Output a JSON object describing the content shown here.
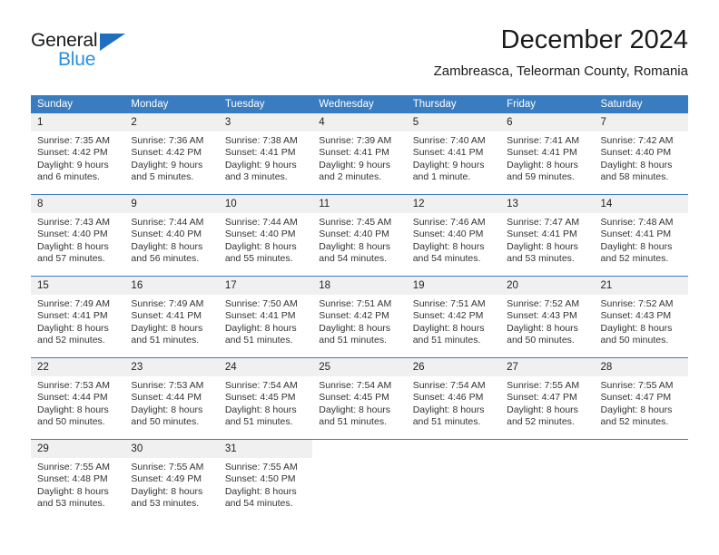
{
  "brand": {
    "name_part1": "General",
    "name_part2": "Blue",
    "triangle_icon": "triangle-icon",
    "blue_accent": "#2a8fe0",
    "dark_text": "#1a1a1a"
  },
  "header": {
    "month_title": "December 2024",
    "location": "Zambreasca, Teleorman County, Romania"
  },
  "calendar": {
    "header_color": "#3a7cc0",
    "daynum_bg": "#f0f0f0",
    "weekdays": [
      "Sunday",
      "Monday",
      "Tuesday",
      "Wednesday",
      "Thursday",
      "Friday",
      "Saturday"
    ],
    "weeks": [
      [
        {
          "day": "1",
          "sunrise": "Sunrise: 7:35 AM",
          "sunset": "Sunset: 4:42 PM",
          "daylight_1": "Daylight: 9 hours",
          "daylight_2": "and 6 minutes."
        },
        {
          "day": "2",
          "sunrise": "Sunrise: 7:36 AM",
          "sunset": "Sunset: 4:42 PM",
          "daylight_1": "Daylight: 9 hours",
          "daylight_2": "and 5 minutes."
        },
        {
          "day": "3",
          "sunrise": "Sunrise: 7:38 AM",
          "sunset": "Sunset: 4:41 PM",
          "daylight_1": "Daylight: 9 hours",
          "daylight_2": "and 3 minutes."
        },
        {
          "day": "4",
          "sunrise": "Sunrise: 7:39 AM",
          "sunset": "Sunset: 4:41 PM",
          "daylight_1": "Daylight: 9 hours",
          "daylight_2": "and 2 minutes."
        },
        {
          "day": "5",
          "sunrise": "Sunrise: 7:40 AM",
          "sunset": "Sunset: 4:41 PM",
          "daylight_1": "Daylight: 9 hours",
          "daylight_2": "and 1 minute."
        },
        {
          "day": "6",
          "sunrise": "Sunrise: 7:41 AM",
          "sunset": "Sunset: 4:41 PM",
          "daylight_1": "Daylight: 8 hours",
          "daylight_2": "and 59 minutes."
        },
        {
          "day": "7",
          "sunrise": "Sunrise: 7:42 AM",
          "sunset": "Sunset: 4:40 PM",
          "daylight_1": "Daylight: 8 hours",
          "daylight_2": "and 58 minutes."
        }
      ],
      [
        {
          "day": "8",
          "sunrise": "Sunrise: 7:43 AM",
          "sunset": "Sunset: 4:40 PM",
          "daylight_1": "Daylight: 8 hours",
          "daylight_2": "and 57 minutes."
        },
        {
          "day": "9",
          "sunrise": "Sunrise: 7:44 AM",
          "sunset": "Sunset: 4:40 PM",
          "daylight_1": "Daylight: 8 hours",
          "daylight_2": "and 56 minutes."
        },
        {
          "day": "10",
          "sunrise": "Sunrise: 7:44 AM",
          "sunset": "Sunset: 4:40 PM",
          "daylight_1": "Daylight: 8 hours",
          "daylight_2": "and 55 minutes."
        },
        {
          "day": "11",
          "sunrise": "Sunrise: 7:45 AM",
          "sunset": "Sunset: 4:40 PM",
          "daylight_1": "Daylight: 8 hours",
          "daylight_2": "and 54 minutes."
        },
        {
          "day": "12",
          "sunrise": "Sunrise: 7:46 AM",
          "sunset": "Sunset: 4:40 PM",
          "daylight_1": "Daylight: 8 hours",
          "daylight_2": "and 54 minutes."
        },
        {
          "day": "13",
          "sunrise": "Sunrise: 7:47 AM",
          "sunset": "Sunset: 4:41 PM",
          "daylight_1": "Daylight: 8 hours",
          "daylight_2": "and 53 minutes."
        },
        {
          "day": "14",
          "sunrise": "Sunrise: 7:48 AM",
          "sunset": "Sunset: 4:41 PM",
          "daylight_1": "Daylight: 8 hours",
          "daylight_2": "and 52 minutes."
        }
      ],
      [
        {
          "day": "15",
          "sunrise": "Sunrise: 7:49 AM",
          "sunset": "Sunset: 4:41 PM",
          "daylight_1": "Daylight: 8 hours",
          "daylight_2": "and 52 minutes."
        },
        {
          "day": "16",
          "sunrise": "Sunrise: 7:49 AM",
          "sunset": "Sunset: 4:41 PM",
          "daylight_1": "Daylight: 8 hours",
          "daylight_2": "and 51 minutes."
        },
        {
          "day": "17",
          "sunrise": "Sunrise: 7:50 AM",
          "sunset": "Sunset: 4:41 PM",
          "daylight_1": "Daylight: 8 hours",
          "daylight_2": "and 51 minutes."
        },
        {
          "day": "18",
          "sunrise": "Sunrise: 7:51 AM",
          "sunset": "Sunset: 4:42 PM",
          "daylight_1": "Daylight: 8 hours",
          "daylight_2": "and 51 minutes."
        },
        {
          "day": "19",
          "sunrise": "Sunrise: 7:51 AM",
          "sunset": "Sunset: 4:42 PM",
          "daylight_1": "Daylight: 8 hours",
          "daylight_2": "and 51 minutes."
        },
        {
          "day": "20",
          "sunrise": "Sunrise: 7:52 AM",
          "sunset": "Sunset: 4:43 PM",
          "daylight_1": "Daylight: 8 hours",
          "daylight_2": "and 50 minutes."
        },
        {
          "day": "21",
          "sunrise": "Sunrise: 7:52 AM",
          "sunset": "Sunset: 4:43 PM",
          "daylight_1": "Daylight: 8 hours",
          "daylight_2": "and 50 minutes."
        }
      ],
      [
        {
          "day": "22",
          "sunrise": "Sunrise: 7:53 AM",
          "sunset": "Sunset: 4:44 PM",
          "daylight_1": "Daylight: 8 hours",
          "daylight_2": "and 50 minutes."
        },
        {
          "day": "23",
          "sunrise": "Sunrise: 7:53 AM",
          "sunset": "Sunset: 4:44 PM",
          "daylight_1": "Daylight: 8 hours",
          "daylight_2": "and 50 minutes."
        },
        {
          "day": "24",
          "sunrise": "Sunrise: 7:54 AM",
          "sunset": "Sunset: 4:45 PM",
          "daylight_1": "Daylight: 8 hours",
          "daylight_2": "and 51 minutes."
        },
        {
          "day": "25",
          "sunrise": "Sunrise: 7:54 AM",
          "sunset": "Sunset: 4:45 PM",
          "daylight_1": "Daylight: 8 hours",
          "daylight_2": "and 51 minutes."
        },
        {
          "day": "26",
          "sunrise": "Sunrise: 7:54 AM",
          "sunset": "Sunset: 4:46 PM",
          "daylight_1": "Daylight: 8 hours",
          "daylight_2": "and 51 minutes."
        },
        {
          "day": "27",
          "sunrise": "Sunrise: 7:55 AM",
          "sunset": "Sunset: 4:47 PM",
          "daylight_1": "Daylight: 8 hours",
          "daylight_2": "and 52 minutes."
        },
        {
          "day": "28",
          "sunrise": "Sunrise: 7:55 AM",
          "sunset": "Sunset: 4:47 PM",
          "daylight_1": "Daylight: 8 hours",
          "daylight_2": "and 52 minutes."
        }
      ],
      [
        {
          "day": "29",
          "sunrise": "Sunrise: 7:55 AM",
          "sunset": "Sunset: 4:48 PM",
          "daylight_1": "Daylight: 8 hours",
          "daylight_2": "and 53 minutes."
        },
        {
          "day": "30",
          "sunrise": "Sunrise: 7:55 AM",
          "sunset": "Sunset: 4:49 PM",
          "daylight_1": "Daylight: 8 hours",
          "daylight_2": "and 53 minutes."
        },
        {
          "day": "31",
          "sunrise": "Sunrise: 7:55 AM",
          "sunset": "Sunset: 4:50 PM",
          "daylight_1": "Daylight: 8 hours",
          "daylight_2": "and 54 minutes."
        },
        {
          "day": "",
          "sunrise": "",
          "sunset": "",
          "daylight_1": "",
          "daylight_2": ""
        },
        {
          "day": "",
          "sunrise": "",
          "sunset": "",
          "daylight_1": "",
          "daylight_2": ""
        },
        {
          "day": "",
          "sunrise": "",
          "sunset": "",
          "daylight_1": "",
          "daylight_2": ""
        },
        {
          "day": "",
          "sunrise": "",
          "sunset": "",
          "daylight_1": "",
          "daylight_2": ""
        }
      ]
    ]
  }
}
